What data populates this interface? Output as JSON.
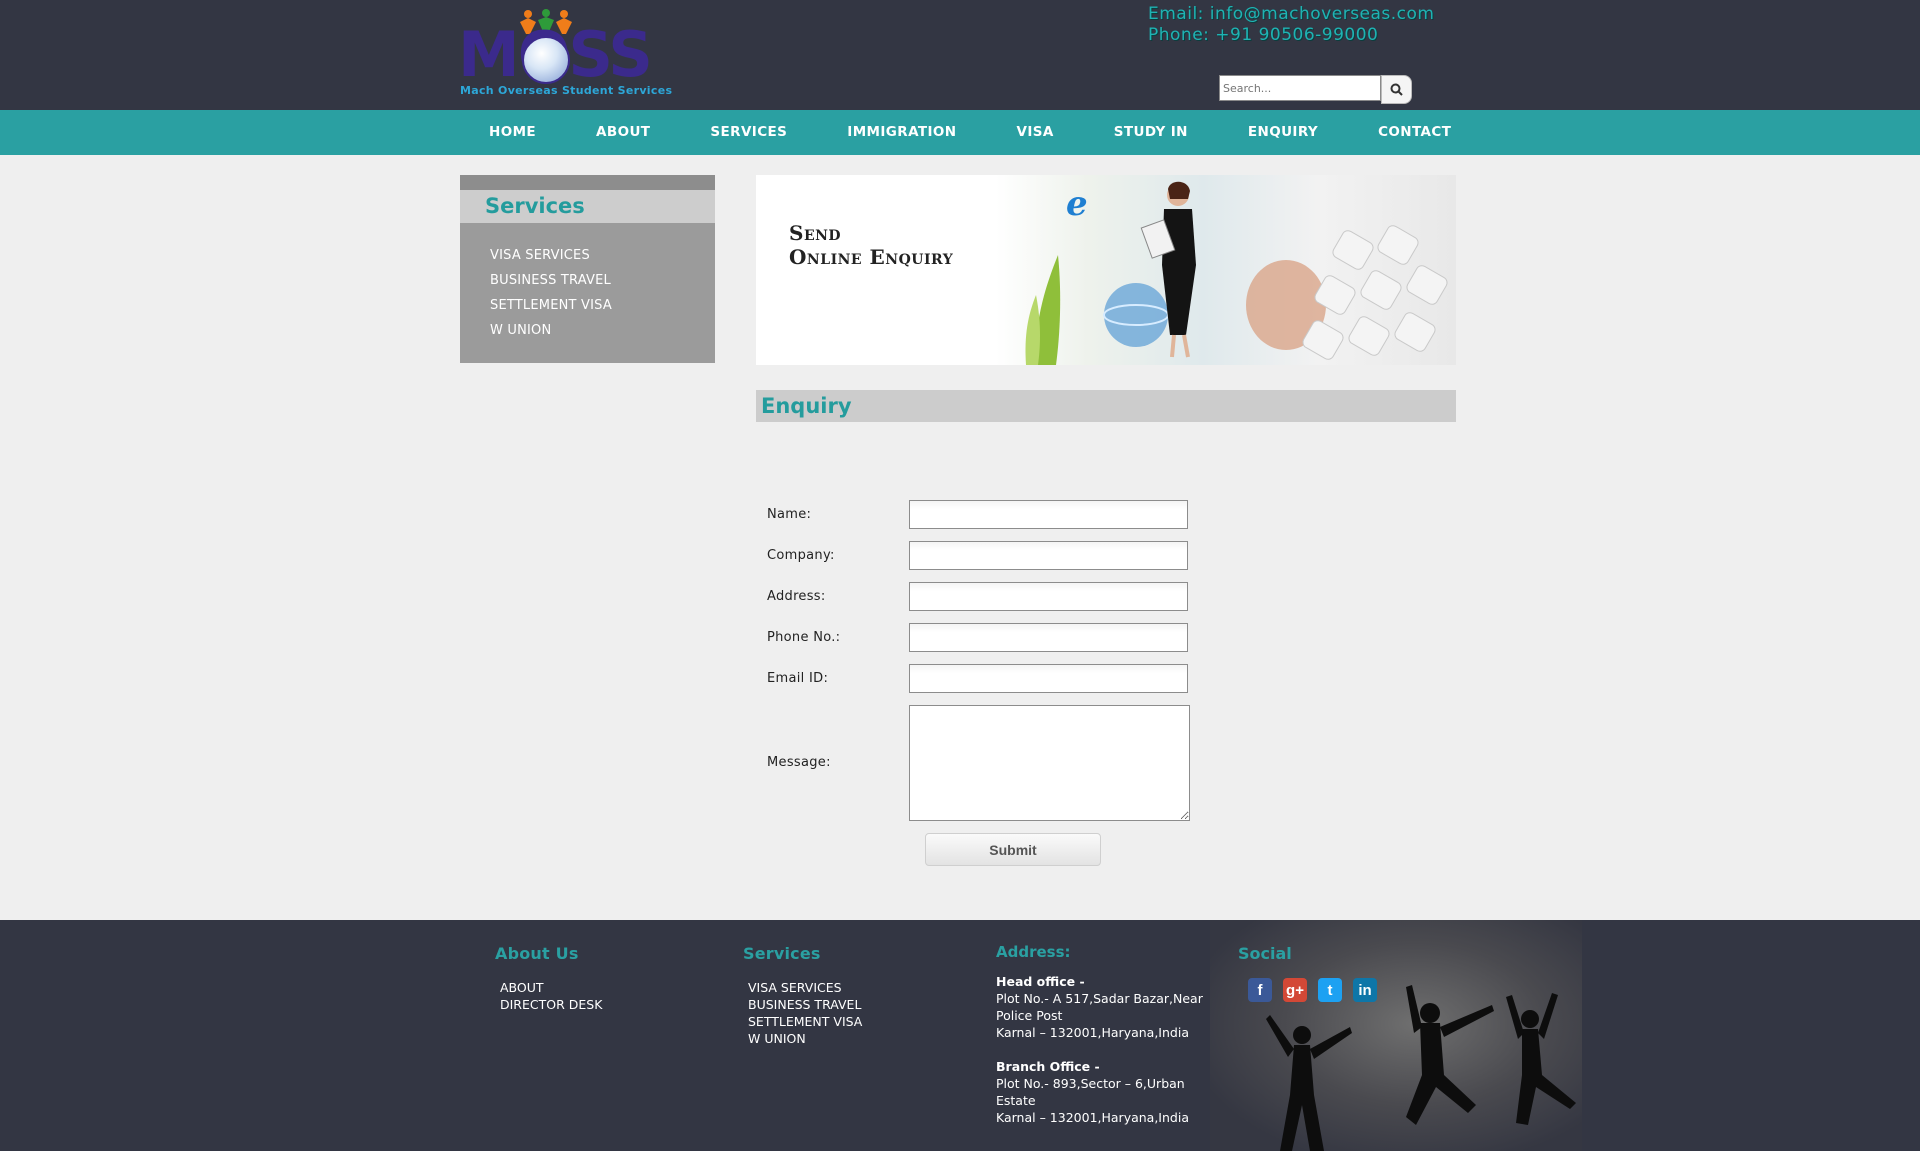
{
  "header": {
    "logo_text": "MOSS",
    "logo_tagline": "Mach Overseas Student Services",
    "email": "Email: info@machoverseas.com",
    "phone": "Phone: +91 90506-99000",
    "search_placeholder": "Search..."
  },
  "nav": {
    "items": [
      "HOME",
      "ABOUT",
      "SERVICES",
      "IMMIGRATION",
      "VISA",
      "STUDY IN",
      "ENQUIRY",
      "CONTACT"
    ]
  },
  "sidebar": {
    "title": "Services",
    "items": [
      "VISA SERVICES",
      "BUSINESS TRAVEL",
      "SETTLEMENT VISA",
      "W UNION"
    ]
  },
  "banner": {
    "line1": "Send",
    "line2": "Online Enquiry"
  },
  "enquiry": {
    "title": "Enquiry",
    "fields": {
      "name": "Name:",
      "company": "Company:",
      "address": "Address:",
      "phone": "Phone No.:",
      "email": "Email ID:",
      "message": "Message:"
    },
    "submit_label": "Submit"
  },
  "footer": {
    "about": {
      "title": "About Us",
      "items": [
        "ABOUT",
        "DIRECTOR DESK"
      ]
    },
    "services": {
      "title": "Services",
      "items": [
        "VISA SERVICES",
        "BUSINESS TRAVEL",
        "SETTLEMENT VISA",
        "W UNION"
      ]
    },
    "address": {
      "title": "Address:",
      "head_label": "Head office -",
      "head_line1": "Plot No.- A 517,Sadar Bazar,Near Police Post",
      "head_line2": "Karnal – 132001,Haryana,India",
      "branch_label": "Branch Office -",
      "branch_line1": "Plot No.- 893,Sector – 6,Urban Estate",
      "branch_line2": "Karnal – 132001,Haryana,India"
    },
    "social": {
      "title": "Social",
      "icons": [
        {
          "name": "facebook-icon",
          "glyph": "f",
          "color": "#3b5998"
        },
        {
          "name": "google-plus-icon",
          "glyph": "g+",
          "color": "#d34836"
        },
        {
          "name": "twitter-icon",
          "glyph": "t",
          "color": "#1da1f2"
        },
        {
          "name": "linkedin-icon",
          "glyph": "in",
          "color": "#0e76a8"
        }
      ]
    }
  },
  "colors": {
    "header_bg": "#333643",
    "accent": "#2aa0a2",
    "page_bg": "#efefef"
  }
}
